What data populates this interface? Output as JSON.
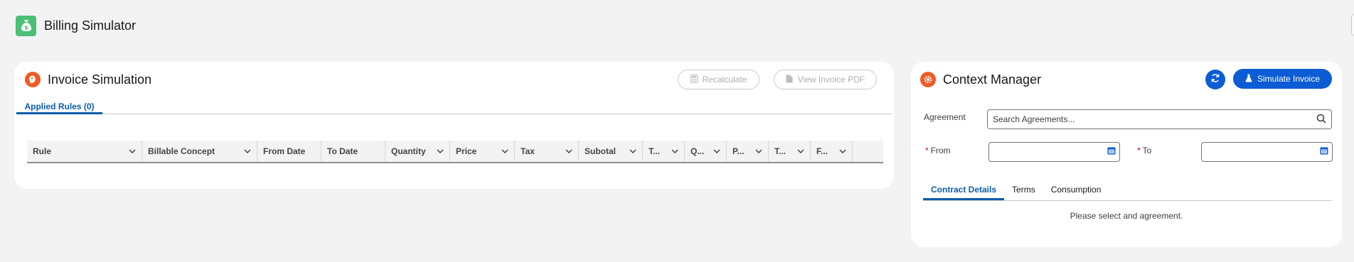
{
  "app": {
    "title": "Billing Simulator"
  },
  "invoice_card": {
    "title": "Invoice Simulation",
    "recalculate_label": "Recalculate",
    "view_pdf_label": "View Invoice PDF",
    "tab_label": "Applied Rules (0)",
    "columns": [
      {
        "label": "Rule",
        "dropdown": true
      },
      {
        "label": "Billable Concept",
        "dropdown": true
      },
      {
        "label": "From Date",
        "dropdown": false
      },
      {
        "label": "To Date",
        "dropdown": false
      },
      {
        "label": "Quantity",
        "dropdown": true
      },
      {
        "label": "Price",
        "dropdown": true
      },
      {
        "label": "Tax",
        "dropdown": true
      },
      {
        "label": "Subotal",
        "dropdown": true
      },
      {
        "label": "T...",
        "dropdown": true
      },
      {
        "label": "Q...",
        "dropdown": true
      },
      {
        "label": "P...",
        "dropdown": true
      },
      {
        "label": "T...",
        "dropdown": true
      },
      {
        "label": "F...",
        "dropdown": true
      }
    ]
  },
  "context_card": {
    "title": "Context Manager",
    "simulate_label": "Simulate Invoice",
    "agreement_label": "Agreement",
    "search_placeholder": "Search Agreements...",
    "from_label": "From",
    "to_label": "To",
    "tabs": [
      "Contract Details",
      "Terms",
      "Consumption"
    ],
    "empty_message": "Please select and agreement."
  },
  "colors": {
    "brand_blue": "#0b5cd5",
    "app_icon_green": "#4bc076",
    "card_icon_orange": "#f05a26"
  }
}
